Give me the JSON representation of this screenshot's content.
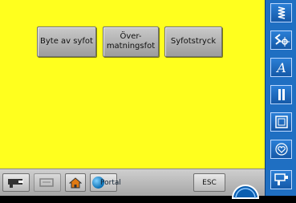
{
  "main": {
    "background": "#ffff1e",
    "buttons": [
      {
        "label": "Byte av syfot"
      },
      {
        "label": "Över-\nmatningsfot"
      },
      {
        "label": "Syfotstryck"
      }
    ]
  },
  "bottombar": {
    "buttons": [
      {
        "icon": "machine-settings-icon"
      },
      {
        "icon": "tutorial-icon"
      },
      {
        "icon": "home-icon"
      },
      {
        "label": "Portal",
        "icon": "globe-icon"
      },
      {
        "label": "ESC"
      }
    ],
    "knob_icon": "stitch-width-knob-icon"
  },
  "sidebar": {
    "items": [
      {
        "icon": "stitch-select-icon"
      },
      {
        "icon": "stitch-alter-icon"
      },
      {
        "icon": "alphabet-icon"
      },
      {
        "icon": "buttonhole-icon"
      },
      {
        "icon": "quilt-square-icon"
      },
      {
        "icon": "heart-icon"
      },
      {
        "icon": "needle-down-icon"
      }
    ]
  },
  "colors": {
    "screen_bg": "#ffff1e",
    "sidebar_bg": "#1f6fc2",
    "button_gray": "#b3b3b3"
  }
}
